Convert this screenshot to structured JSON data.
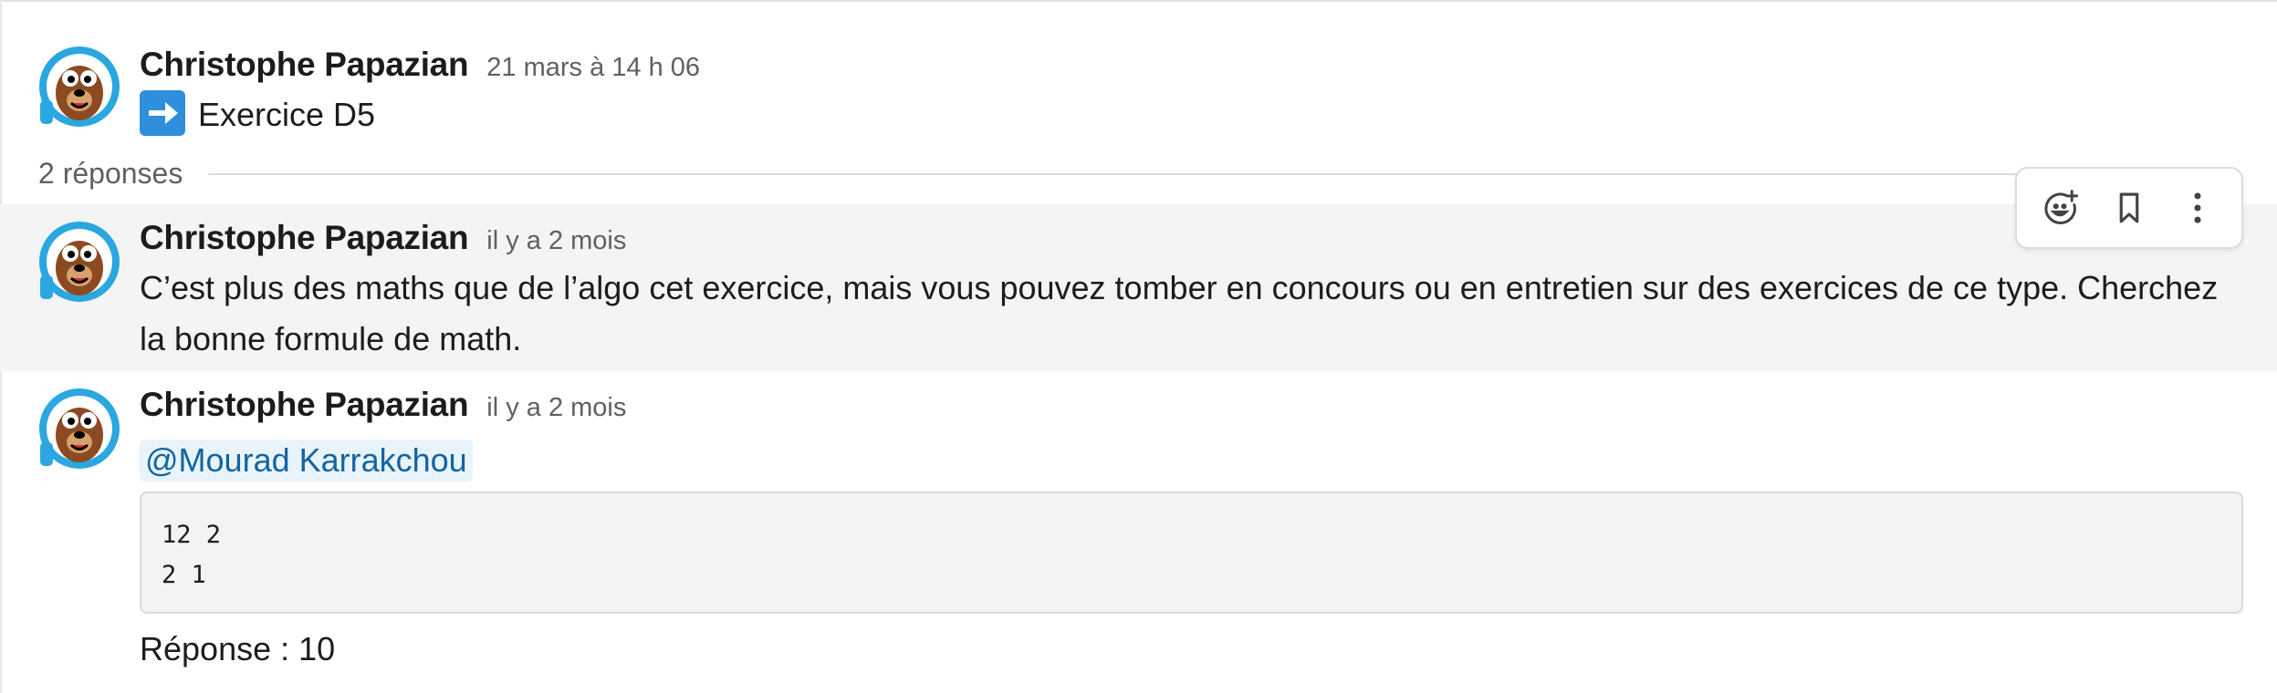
{
  "messages": [
    {
      "author": "Christophe Papazian",
      "time": "21 mars à 14 h 06",
      "emoji": "arrow-right-emoji",
      "text": "Exercice D5"
    },
    {
      "author": "Christophe Papazian",
      "time": "il y a 2 mois",
      "text": "C’est plus des maths que de l’algo cet exercice, mais vous pouvez tomber en concours ou en entretien sur des exercices de ce type. Cherchez la bonne formule de math."
    },
    {
      "author": "Christophe Papazian",
      "time": "il y a 2 mois",
      "mention": "@Mourad Karrakchou",
      "code": [
        "12 2",
        "2 1"
      ],
      "text": "Réponse : 10"
    }
  ],
  "thread": {
    "replies_label": "2 réponses"
  },
  "actions": [
    {
      "icon": "add-reaction-icon"
    },
    {
      "icon": "bookmark-icon"
    },
    {
      "icon": "more-vertical-icon"
    }
  ],
  "colors": {
    "mention_bg": "#e8f4fa",
    "mention_text": "#1264a3",
    "hover_bg": "#f4f4f4",
    "emoji_blue": "#2f8fdc"
  }
}
